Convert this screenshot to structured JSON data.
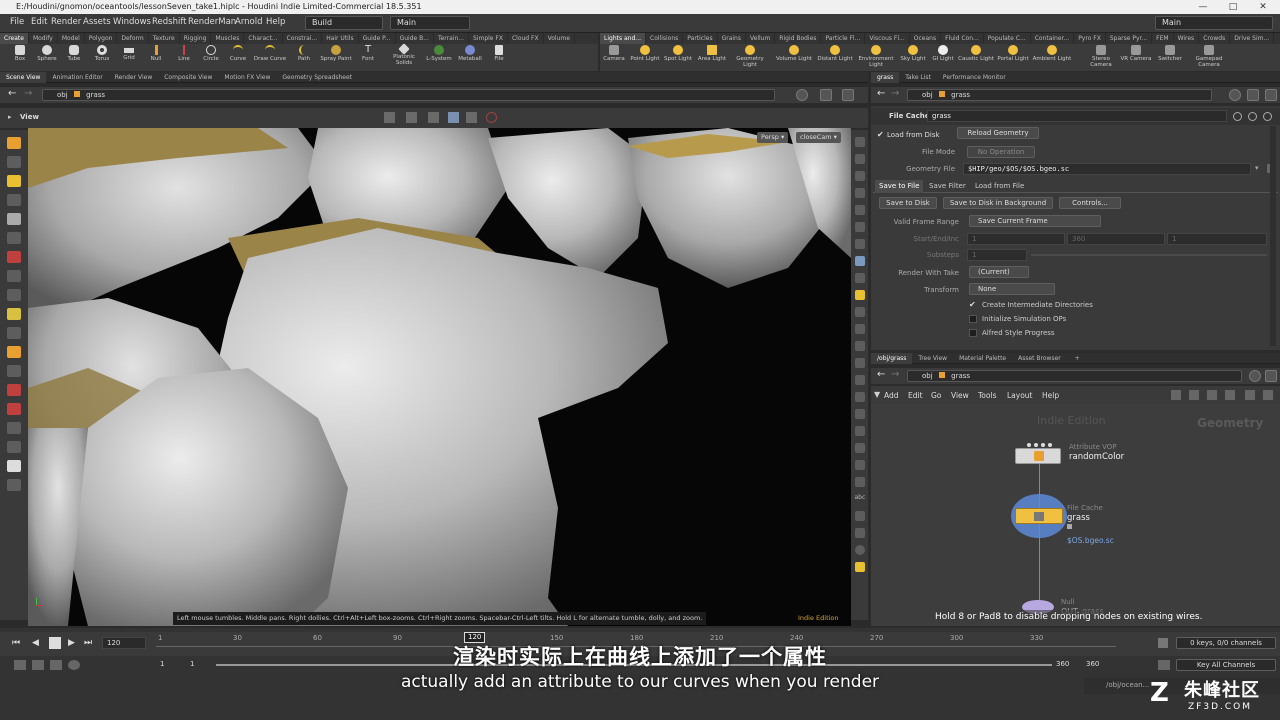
{
  "window": {
    "title": "E:/Houdini/gnomon/oceantools/lessonSeven_take1.hiplc - Houdini Indie Limited-Commercial 18.5.351"
  },
  "menu": {
    "items": [
      "File",
      "Edit",
      "Render",
      "Assets",
      "Windows",
      "Redshift",
      "RenderMan",
      "Arnold",
      "Help"
    ],
    "desktop": "Build",
    "main": "Main",
    "right_main": "Main"
  },
  "shelf_tabs_left": [
    "Create",
    "Modify",
    "Model",
    "Polygon",
    "Deform",
    "Texture",
    "Rigging",
    "Muscles",
    "Charact...",
    "Constrai...",
    "Hair Utils",
    "Guide P...",
    "Guide B...",
    "Terrain...",
    "Simple FX",
    "Cloud FX",
    "Volume"
  ],
  "shelf_tabs_right": [
    "Lights and...",
    "Collisions",
    "Particles",
    "Grains",
    "Vellum",
    "Rigid Bodies",
    "Particle Fl...",
    "Viscous Fl...",
    "Oceans",
    "Fluid Con...",
    "Populate C...",
    "Container...",
    "Pyro FX",
    "Sparse Pyr...",
    "FEM",
    "Wires",
    "Crowds",
    "Drive Sim..."
  ],
  "tools_left": [
    "Box",
    "Sphere",
    "Tube",
    "Torus",
    "Grid",
    "Null",
    "Line",
    "Circle",
    "Curve",
    "Draw Curve",
    "Path",
    "Spray Paint",
    "Font",
    "Platonic Solids",
    "L-System",
    "Metaball",
    "File"
  ],
  "tools_right": [
    "Camera",
    "Point Light",
    "Spot Light",
    "Area Light",
    "Geometry Light",
    "Volume Light",
    "Distant Light",
    "Environment Light",
    "Sky Light",
    "GI Light",
    "Caustic Light",
    "Portal Light",
    "Ambient Light",
    "Stereo Camera",
    "VR Camera",
    "Switcher",
    "Gamepad Camera"
  ],
  "viewer_tabs": [
    "Scene View",
    "Animation Editor",
    "Render View",
    "Composite View",
    "Motion FX View",
    "Geometry Spreadsheet"
  ],
  "path": {
    "obj": "obj",
    "node": "grass"
  },
  "viewport": {
    "label": "View",
    "persp": "Persp",
    "cam": "closeCam",
    "hint": "Left mouse tumbles. Middle pans. Right dollies. Ctrl+Alt+Left box-zooms. Ctrl+Right zooms. Spacebar-Ctrl-Left tilts. Hold L for alternate tumble, dolly, and zoom.",
    "edition": "Indie Edition"
  },
  "params_tabs": [
    "grass",
    "Take List",
    "Performance Monitor"
  ],
  "params": {
    "node_type": "File Cache",
    "node_name": "grass",
    "load_from_disk": "Load from Disk",
    "reload": "Reload Geometry",
    "file_mode_label": "File Mode",
    "file_mode": "No Operation",
    "geo_file_label": "Geometry File",
    "geo_file": "$HIP/geo/$OS/$OS.bgeo.sc",
    "subtabs": [
      "Save to File",
      "Save Filter",
      "Load from File"
    ],
    "buttons": [
      "Save to Disk",
      "Save to Disk in Background",
      "Controls..."
    ],
    "vfr_label": "Valid Frame Range",
    "vfr": "Save Current Frame",
    "sei_label": "Start/End/Inc",
    "sei": [
      "1",
      "360",
      "1"
    ],
    "substeps_label": "Substeps",
    "substeps": "1",
    "rwt_label": "Render With Take",
    "rwt": "(Current)",
    "transform_label": "Transform",
    "transform": "None",
    "checks": [
      "Create Intermediate Directories",
      "Initialize Simulation OPs",
      "Alfred Style Progress"
    ]
  },
  "network_tabs": [
    "/obj/grass",
    "Tree View",
    "Material Palette",
    "Asset Browser"
  ],
  "network_menu": [
    "Add",
    "Edit",
    "Go",
    "View",
    "Tools",
    "Layout",
    "Help"
  ],
  "network": {
    "watermark": "Indie Edition",
    "context": "Geometry",
    "node1_type": "Attribute VOP",
    "node1_name": "randomColor",
    "node2_type": "File Cache",
    "node2_name": "grass",
    "node2_info": "$OS.bgeo.sc",
    "node3_type": "Null",
    "node3_name": "OUT_grass",
    "hint": "Hold 8 or Pad8 to disable dropping nodes on existing wires."
  },
  "timeline": {
    "frame": "120",
    "marker": "120",
    "ticks": [
      "1",
      "30",
      "60",
      "90",
      "150",
      "180",
      "210",
      "240",
      "270",
      "300",
      "330"
    ],
    "start": "1",
    "start2": "1",
    "end": "360",
    "end2": "360",
    "keys": "0 keys, 0/0 channels",
    "key_all": "Key All Channels",
    "path": "/obj/ocean..."
  },
  "subtitles": {
    "zh": "渲染时实际上在曲线上添加了一个属性",
    "en": "actually add an attribute to our curves when you render"
  },
  "logo": {
    "text": "朱峰社区",
    "url": "ZF3D.COM"
  }
}
